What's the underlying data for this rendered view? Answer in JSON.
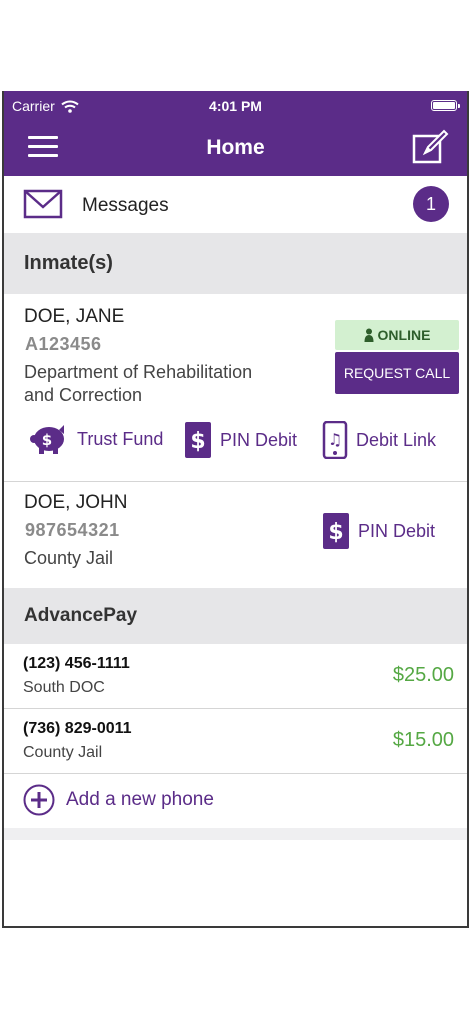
{
  "status_bar": {
    "carrier": "Carrier",
    "time": "4:01 PM"
  },
  "nav": {
    "title": "Home",
    "menu_icon": "hamburger-icon",
    "compose_icon": "compose-icon"
  },
  "messages": {
    "label": "Messages",
    "count": "1",
    "icon": "envelope-icon"
  },
  "inmates_section": {
    "title": "Inmate(s)"
  },
  "inmates": [
    {
      "name": "DOE, JANE",
      "id": "A123456",
      "facility_line1": "Department of Rehabilitation",
      "facility_line2": "and Correction",
      "online_label": "ONLINE",
      "request_call_label": "REQUEST CALL",
      "actions": [
        {
          "label": "Trust Fund",
          "icon": "piggy-bank-icon"
        },
        {
          "label": "PIN Debit",
          "icon": "dollar-icon"
        },
        {
          "label": "Debit Link",
          "icon": "phone-music-icon"
        }
      ]
    },
    {
      "name": "DOE, JOHN",
      "id": "987654321",
      "facility_line1": "County Jail",
      "actions": [
        {
          "label": "PIN Debit",
          "icon": "dollar-icon"
        }
      ]
    }
  ],
  "advancepay": {
    "title": "AdvancePay",
    "phones": [
      {
        "number": "(123) 456-1111",
        "facility": "South DOC",
        "amount": "$25.00"
      },
      {
        "number": "(736) 829-0011",
        "facility": "County Jail",
        "amount": "$15.00"
      }
    ],
    "add_label": "Add a new phone"
  },
  "colors": {
    "brand": "#5b2c88",
    "online_bg": "#d3f0d0",
    "amount": "#55a844",
    "section_bg": "#e6e6e8"
  }
}
